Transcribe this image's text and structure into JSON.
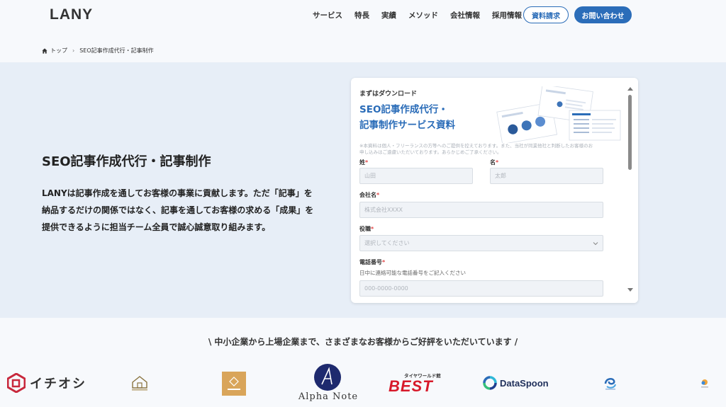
{
  "header": {
    "logo": "LANY",
    "nav": [
      "サービス",
      "特長",
      "実績",
      "メソッド",
      "会社情報",
      "採用情報"
    ],
    "doc_button": "資料請求",
    "contact_button": "お問い合わせ"
  },
  "breadcrumb": {
    "home": "トップ",
    "current": "SEO記事作成代行・記事制作"
  },
  "hero": {
    "title": "SEO記事作成代行・記事制作",
    "lines": [
      "LANYは記事作成を通してお客様の事業に貢献します。ただ「記事」を",
      "納品するだけの関係ではなく、記事を通してお客様の求める「成果」を",
      "提供できるように担当チーム全員で誠心誠意取り組みます。"
    ]
  },
  "form": {
    "download_label": "まずはダウンロード",
    "title_line1": "SEO記事作成代行・",
    "title_line2": "記事制作サービス資料",
    "notice_line1": "※本資料は個人・フリーランスの方等へのご提供を控えております。また、当社が同業他社と判断したお客様のお",
    "notice_line2": "申し込みはご遠慮いただいております。あらかじめご了承ください。",
    "last_name_label": "姓",
    "last_name_placeholder": "山田",
    "first_name_label": "名",
    "first_name_placeholder": "太郎",
    "company_label": "会社名",
    "company_placeholder": "株式会社XXXX",
    "position_label": "役職",
    "position_value": "選択してください",
    "phone_label": "電話番号",
    "phone_hint": "日中に連絡可能な電話番号をご記入ください",
    "phone_placeholder": "000-0000-0000",
    "required_mark": "*"
  },
  "clients": {
    "tagline": "\\ 中小企業から上場企業まで、さまざまなお客様からご好評をいただいています /",
    "ichioshi": "イチオシ",
    "alpha_note": "Alpha Note",
    "tire_world_small": "タイヤワールド館",
    "best": "BEST",
    "dataspoon": "DataSpoon"
  },
  "colors": {
    "accent": "#2a6cb8",
    "hero_bg": "#e7eef7",
    "required": "#e04a4a",
    "best_red": "#d7192a",
    "ichioshi_red": "#c8283c"
  }
}
